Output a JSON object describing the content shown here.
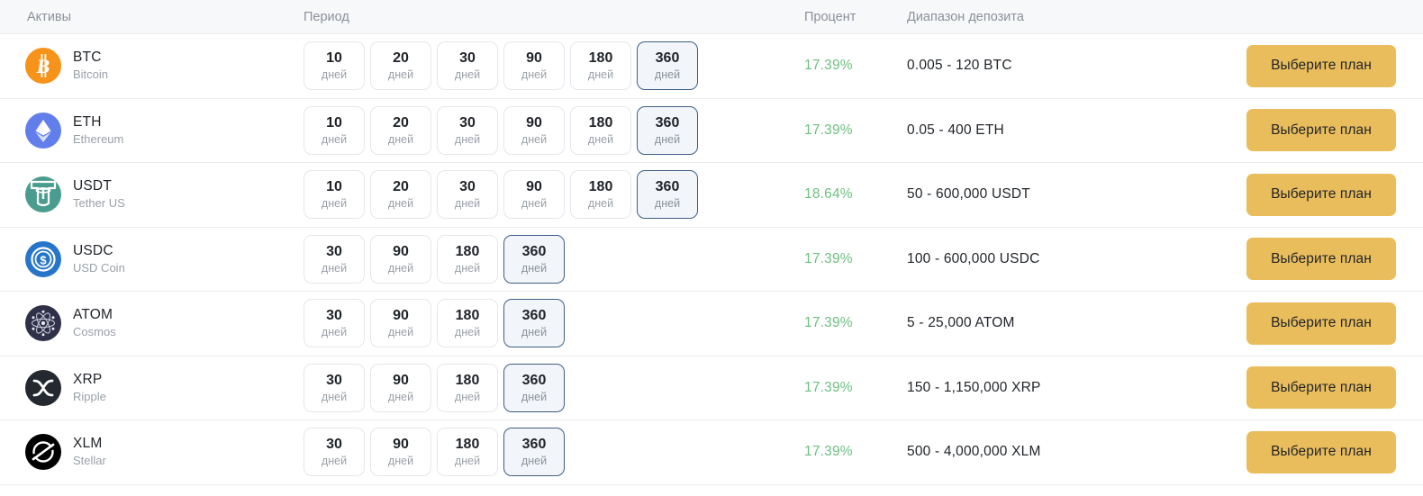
{
  "table": {
    "headers": {
      "assets": "Активы",
      "period": "Период",
      "percent": "Процент",
      "range": "Диапазон депозита"
    },
    "action_label": "Выберите план",
    "day_unit": "дней",
    "colors": {
      "header_bg": "#f7f8fa",
      "header_text": "#8b9099",
      "row_border": "#e9ebef",
      "percent_green": "#6cc07f",
      "button_gold": "#eabd5c",
      "chip_border": "#e4e7ec",
      "chip_selected_border": "#3f5f86",
      "chip_selected_bg": "#f2f5fa",
      "text_primary": "#1f2328",
      "text_muted": "#9aa0a8"
    },
    "rows": [
      {
        "symbol": "BTC",
        "name": "Bitcoin",
        "icon": "bitcoin-icon",
        "icon_color": "#f7931a",
        "periods": [
          10,
          20,
          30,
          90,
          180,
          360
        ],
        "selected_period": 360,
        "percent": "17.39%",
        "range": "0.005 - 120 BTC"
      },
      {
        "symbol": "ETH",
        "name": "Ethereum",
        "icon": "ethereum-icon",
        "icon_color": "#627eea",
        "periods": [
          10,
          20,
          30,
          90,
          180,
          360
        ],
        "selected_period": 360,
        "percent": "17.39%",
        "range": "0.05 - 400 ETH"
      },
      {
        "symbol": "USDT",
        "name": "Tether US",
        "icon": "tether-icon",
        "icon_color": "#4a9d8e",
        "periods": [
          10,
          20,
          30,
          90,
          180,
          360
        ],
        "selected_period": 360,
        "percent": "18.64%",
        "range": "50 - 600,000 USDT"
      },
      {
        "symbol": "USDC",
        "name": "USD Coin",
        "icon": "usdcoin-icon",
        "icon_color": "#2775ca",
        "periods": [
          30,
          90,
          180,
          360
        ],
        "selected_period": 360,
        "percent": "17.39%",
        "range": "100 - 600,000 USDC"
      },
      {
        "symbol": "ATOM",
        "name": "Cosmos",
        "icon": "cosmos-icon",
        "icon_color": "#2e3148",
        "periods": [
          30,
          90,
          180,
          360
        ],
        "selected_period": 360,
        "percent": "17.39%",
        "range": "5 - 25,000 ATOM"
      },
      {
        "symbol": "XRP",
        "name": "Ripple",
        "icon": "ripple-icon",
        "icon_color": "#23292f",
        "periods": [
          30,
          90,
          180,
          360
        ],
        "selected_period": 360,
        "percent": "17.39%",
        "range": "150 - 1,150,000 XRP"
      },
      {
        "symbol": "XLM",
        "name": "Stellar",
        "icon": "stellar-icon",
        "icon_color": "#000000",
        "periods": [
          30,
          90,
          180,
          360
        ],
        "selected_period": 360,
        "percent": "17.39%",
        "range": "500 - 4,000,000 XLM"
      }
    ]
  }
}
